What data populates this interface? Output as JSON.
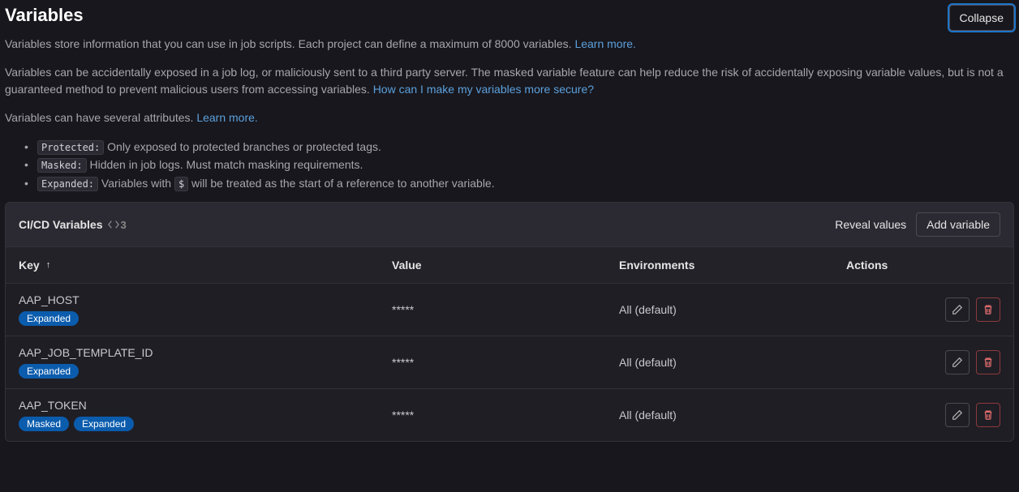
{
  "title": "Variables",
  "collapse_label": "Collapse",
  "intro_text": "Variables store information that you can use in job scripts. Each project can define a maximum of 8000 variables.",
  "learn_more": "Learn more.",
  "warning_text": "Variables can be accidentally exposed in a job log, or maliciously sent to a third party server. The masked variable feature can help reduce the risk of accidentally exposing variable values, but is not a guaranteed method to prevent malicious users from accessing variables.",
  "secure_link": "How can I make my variables more secure?",
  "attributes_intro": "Variables can have several attributes.",
  "attributes": {
    "protected_label": "Protected:",
    "protected_desc": " Only exposed to protected branches or protected tags.",
    "masked_label": "Masked:",
    "masked_desc": " Hidden in job logs. Must match masking requirements.",
    "expanded_label": "Expanded:",
    "expanded_desc_a": " Variables with ",
    "expanded_code": "$",
    "expanded_desc_b": " will be treated as the start of a reference to another variable."
  },
  "card": {
    "title": "CI/CD Variables",
    "count": "3",
    "reveal_label": "Reveal values",
    "add_label": "Add variable",
    "columns": {
      "key": "Key",
      "value": "Value",
      "env": "Environments",
      "actions": "Actions"
    }
  },
  "rows": [
    {
      "key": "AAP_HOST",
      "value": "*****",
      "env": "All (default)",
      "badges": [
        "Expanded"
      ]
    },
    {
      "key": "AAP_JOB_TEMPLATE_ID",
      "value": "*****",
      "env": "All (default)",
      "badges": [
        "Expanded"
      ]
    },
    {
      "key": "AAP_TOKEN",
      "value": "*****",
      "env": "All (default)",
      "badges": [
        "Masked",
        "Expanded"
      ]
    }
  ]
}
